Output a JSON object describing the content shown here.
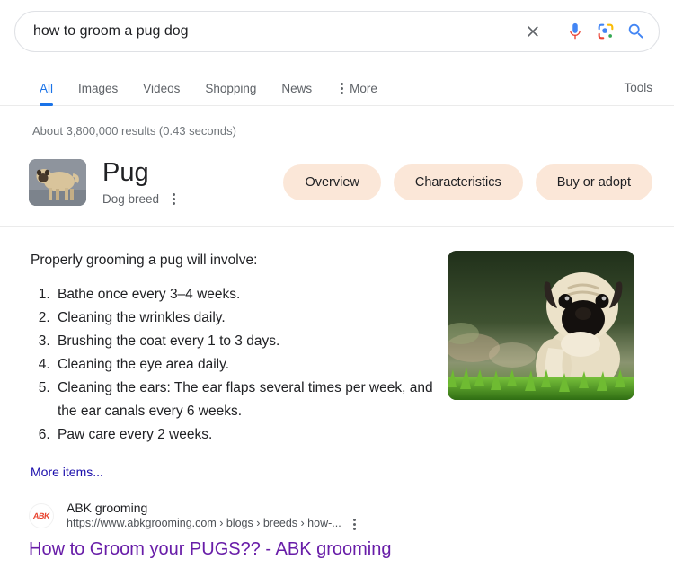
{
  "search": {
    "query": "how to groom a pug dog",
    "placeholder": "Search",
    "clear_icon": "close-icon",
    "voice_icon": "microphone-icon",
    "lens_icon": "google-lens-icon",
    "submit_icon": "search-icon"
  },
  "tabs": {
    "items": [
      {
        "label": "All",
        "active": true
      },
      {
        "label": "Images",
        "active": false
      },
      {
        "label": "Videos",
        "active": false
      },
      {
        "label": "Shopping",
        "active": false
      },
      {
        "label": "News",
        "active": false
      }
    ],
    "more_label": "More",
    "tools_label": "Tools"
  },
  "result_stats": "About 3,800,000 results (0.43 seconds)",
  "knowledge_panel": {
    "title": "Pug",
    "subtitle": "Dog breed",
    "thumbnail_alt": "pug-thumbnail",
    "pills": [
      {
        "label": "Overview"
      },
      {
        "label": "Characteristics"
      },
      {
        "label": "Buy or adopt"
      }
    ]
  },
  "featured_snippet": {
    "lead": "Properly grooming a pug will involve:",
    "items": [
      "Bathe once every 3–4 weeks.",
      "Cleaning the wrinkles daily.",
      "Brushing the coat every 1 to 3 days.",
      "Cleaning the eye area daily.",
      "Cleaning the ears: The ear flaps several times per week, and the ear canals every 6 weeks.",
      "Paw care every 2 weeks."
    ],
    "more_items_label": "More items...",
    "photo_alt": "pug-in-grass-photo"
  },
  "result": {
    "favicon_text": "ABK",
    "source_name": "ABK grooming",
    "url": "https://www.abkgrooming.com › blogs › breeds › how-...",
    "title": "How to Groom your PUGS?? - ABK grooming"
  },
  "colors": {
    "accent_blue": "#1a73e8",
    "link_blue": "#1a0dab",
    "visited_purple": "#681da8",
    "pill_bg": "#fbe7d8",
    "text_gray": "#5f6368"
  }
}
